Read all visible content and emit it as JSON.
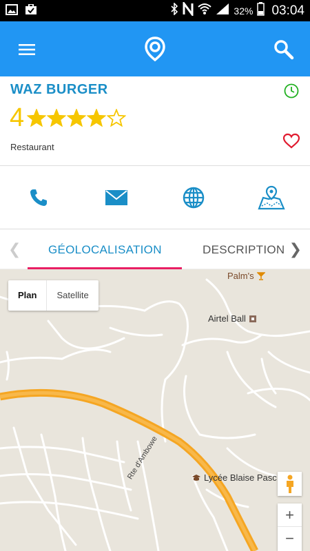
{
  "status_bar": {
    "battery_pct": "32%",
    "clock": "03:04",
    "icons": [
      "image-icon",
      "briefcase-check-icon",
      "bluetooth-icon",
      "nfc-icon",
      "wifi-icon",
      "signal-icon",
      "battery-icon"
    ]
  },
  "app_bar": {
    "color": "#2196F3",
    "icons": [
      "menu-icon",
      "location-pin-logo",
      "search-icon"
    ]
  },
  "place": {
    "name": "WAZ BURGER",
    "rating": "4",
    "stars_filled": 4,
    "stars_total": 5,
    "category": "Restaurant",
    "accent": "#1a8ec7",
    "star_color": "#f6c600"
  },
  "actions": [
    {
      "icon": "phone-icon"
    },
    {
      "icon": "mail-icon"
    },
    {
      "icon": "globe-icon"
    },
    {
      "icon": "map-icon"
    }
  ],
  "tabs": {
    "items": [
      {
        "label": "GÉOLOCALISATION",
        "active": true
      },
      {
        "label": "DESCRIPTION",
        "active": false
      }
    ],
    "indicator_color": "#e91e63"
  },
  "map": {
    "map_type": {
      "plan": "Plan",
      "satellite": "Satellite"
    },
    "pois": {
      "palms": "Palm's",
      "airtel": "Airtel Ball",
      "lycee": "Lycée Blaise Pasc"
    },
    "road_label": "Rte d'Ambowe",
    "zoom_in": "+",
    "zoom_out": "−"
  }
}
